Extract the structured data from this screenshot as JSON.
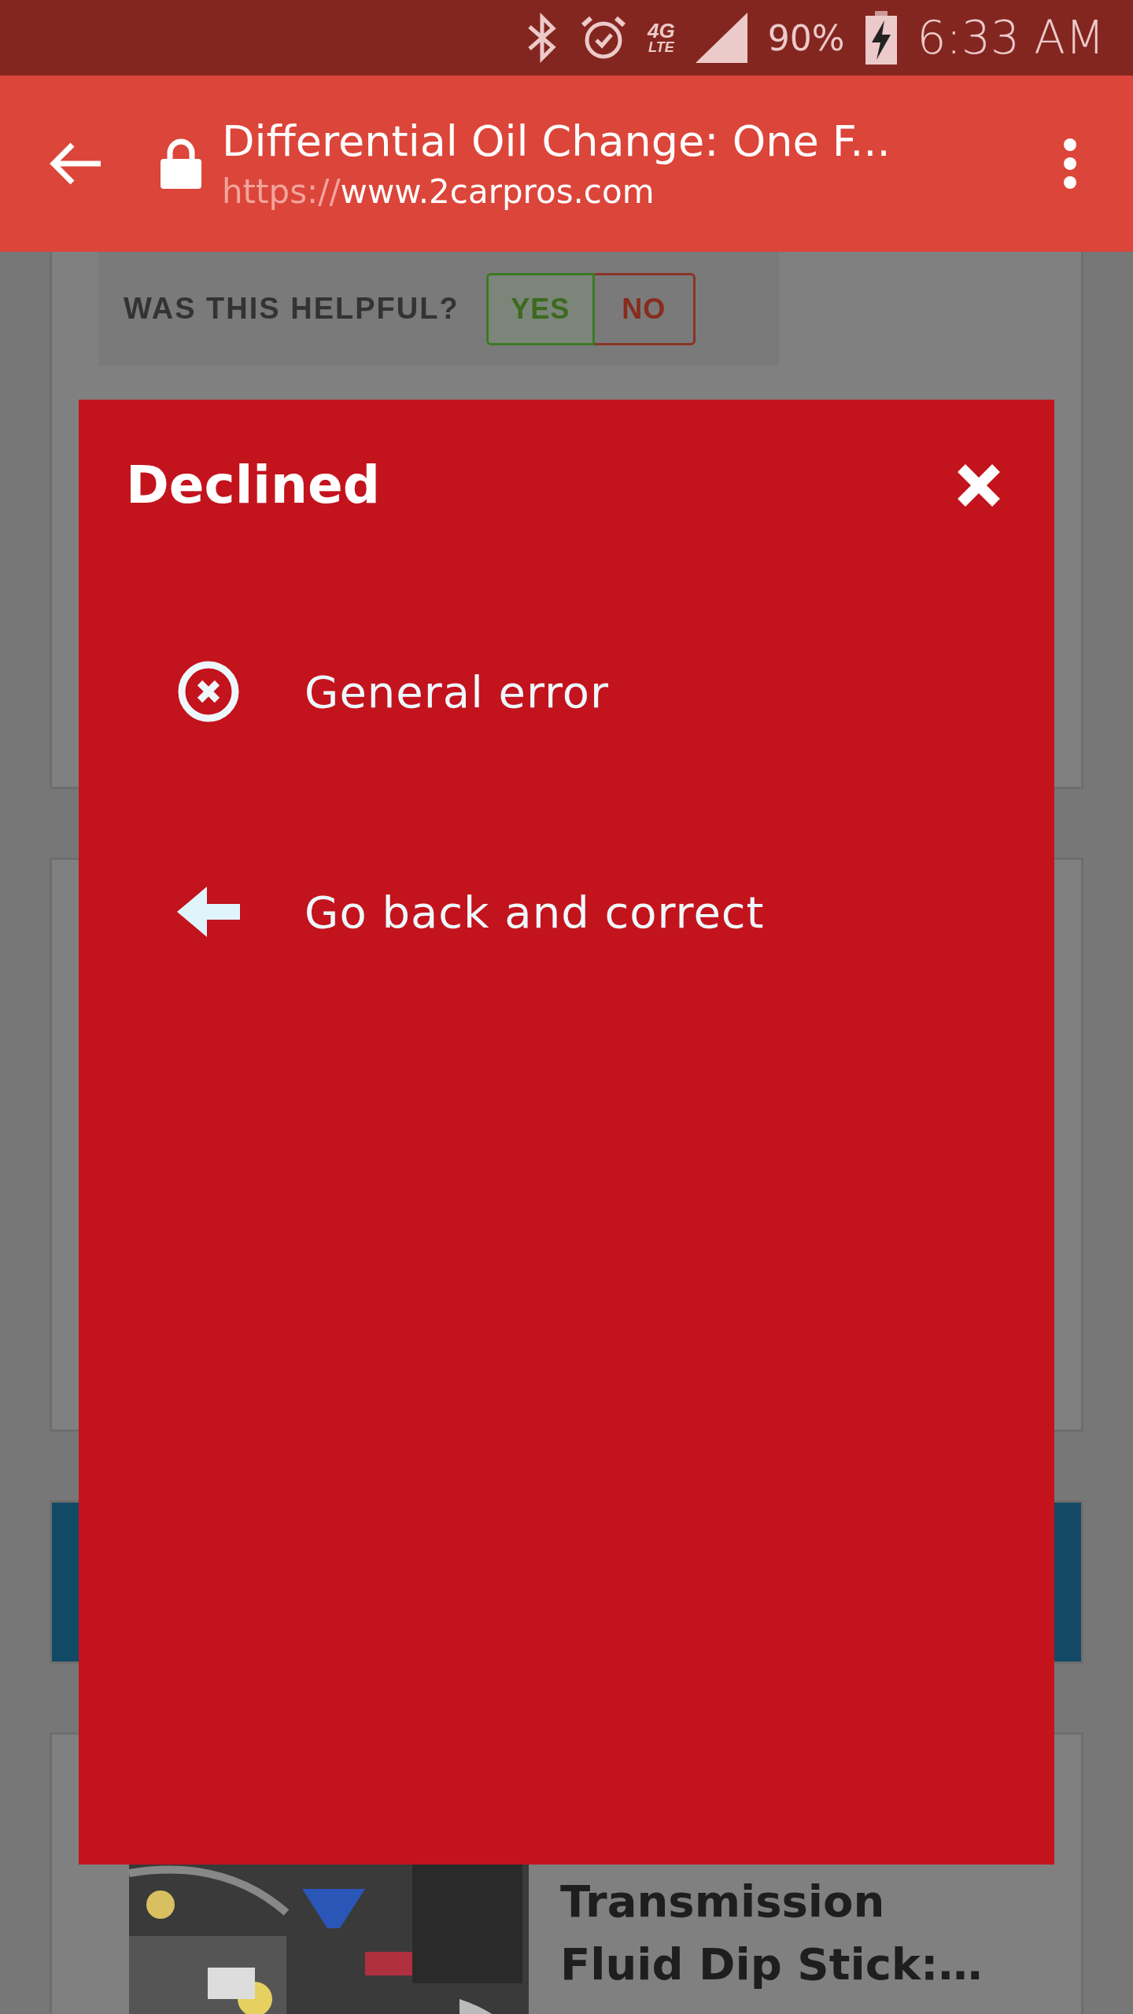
{
  "status_bar": {
    "network_lines": [
      "4G",
      "LTE"
    ],
    "battery": "90%",
    "time": "6:33 AM"
  },
  "toolbar": {
    "title": "Differential Oil Change: One F...",
    "url_scheme": "https://",
    "url_host": "www.2carpros.com"
  },
  "feedback": {
    "question": "WAS THIS HELPFUL?",
    "buttons": [
      {
        "label": "YES",
        "kind": "yes"
      },
      {
        "label": "NO",
        "kind": "no"
      }
    ]
  },
  "dialog": {
    "title": "Declined",
    "items": [
      {
        "kind": "error",
        "label": "General error"
      },
      {
        "kind": "back",
        "label": "Go back and correct"
      }
    ]
  },
  "article_card": {
    "title_lines": [
      "Transmission",
      "Fluid Dip Stick:…"
    ]
  }
}
